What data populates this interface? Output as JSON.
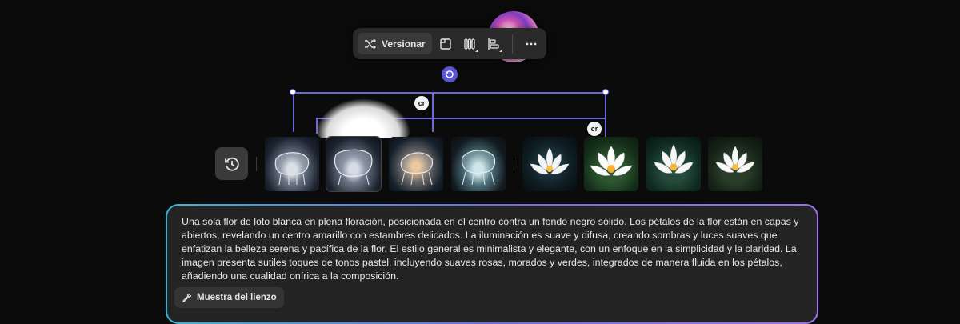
{
  "toolbar": {
    "version_label": "Versionar",
    "icons": [
      "shuffle-icon",
      "frame-icon",
      "columns-icon",
      "align-icon",
      "more-icon"
    ]
  },
  "canvas": {
    "badge_text": "cr"
  },
  "history": {
    "icon": "history-icon"
  },
  "thumbnails": {
    "chairs": [
      "chair-1",
      "chair-2",
      "chair-3",
      "chair-4"
    ],
    "lotus": [
      "lotus-1",
      "lotus-2",
      "lotus-3",
      "lotus-4"
    ]
  },
  "prompt": {
    "text": "Una sola flor de loto blanca en plena floración, posicionada en el centro contra un fondo negro sólido. Los pétalos de la flor están en capas y abiertos, revelando un centro amarillo con estambres delicados. La iluminación es suave y difusa, creando sombras y luces suaves que enfatizan la belleza serena y pacífica de la flor. El estilo general es minimalista y elegante, con un enfoque en la simplicidad y la claridad. La imagen presenta sutiles toques de tonos pastel, incluyendo suaves rosas, morados y verdes, integrados de manera fluida en los pétalos, añadiendo una cualidad onírica a la composición.",
    "chip_label": "Muestra del lienzo"
  },
  "colors": {
    "selection": "#6d68d8",
    "background": "#0b0b0b",
    "panel": "#242424"
  }
}
